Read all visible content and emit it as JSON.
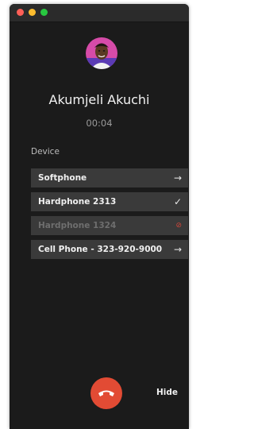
{
  "call": {
    "caller_name": "Akumjeli Akuchi",
    "elapsed": "00:04"
  },
  "devices": {
    "label": "Device",
    "items": [
      {
        "label": "Softphone",
        "icon": "arrow-right-icon",
        "state": "available"
      },
      {
        "label": "Hardphone 2313",
        "icon": "checkmark-icon",
        "state": "selected"
      },
      {
        "label": "Hardphone 1324",
        "icon": "blocked-icon",
        "state": "disabled"
      },
      {
        "label": "Cell Phone - 323-920-9000",
        "icon": "arrow-right-icon",
        "state": "available"
      }
    ]
  },
  "controls": {
    "hangup_icon": "phone-hangup-icon",
    "hide_label": "Hide"
  },
  "colors": {
    "hangup": "#e24b34",
    "blocked": "#d2463a",
    "row_bg": "#3a3a3a",
    "window_bg": "#1b1b1b"
  }
}
